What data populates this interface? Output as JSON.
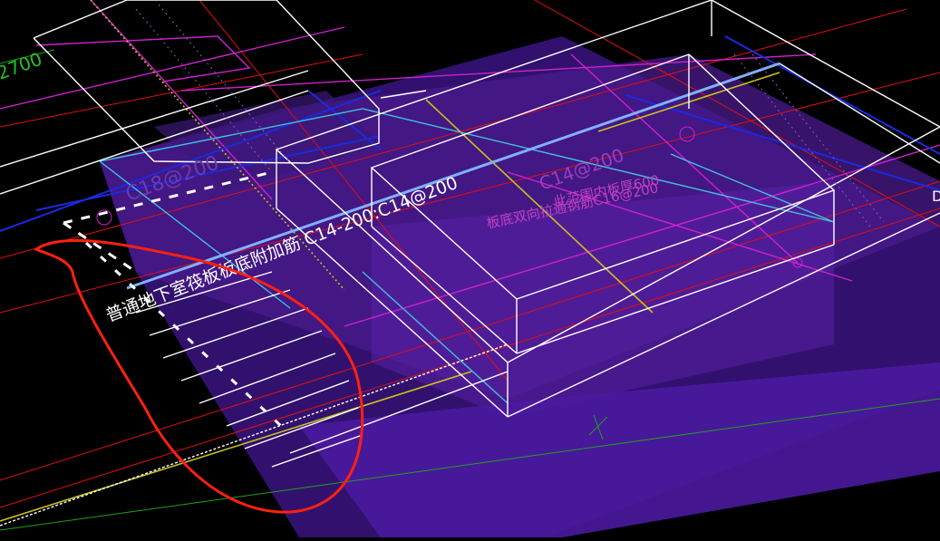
{
  "view": {
    "background": "#000000"
  },
  "labels": {
    "top_left_dim": "2700",
    "slab_rebar_left": "C18@200",
    "slab_rebar_right": "C14@200",
    "main_note": "普通地下室筏板板底附加筋 C14-200:C14@200",
    "range_thickness": "此范围内板厚600",
    "bottom_bidir": "板底双向拉通钢筋C16@200",
    "edge_letter": "D"
  },
  "colors": {
    "slab_fill": "#4a1a8c",
    "slab_fill_dark": "#2e0f5e",
    "white_line": "#ffffff",
    "magenta": "#d020d0",
    "red": "#e01010",
    "blue": "#1a2ae0",
    "yellow": "#c8c020",
    "cyan": "#40c0e0",
    "green": "#20c020",
    "annotation_red": "#ff2010",
    "label_magenta": "#c040c0"
  }
}
